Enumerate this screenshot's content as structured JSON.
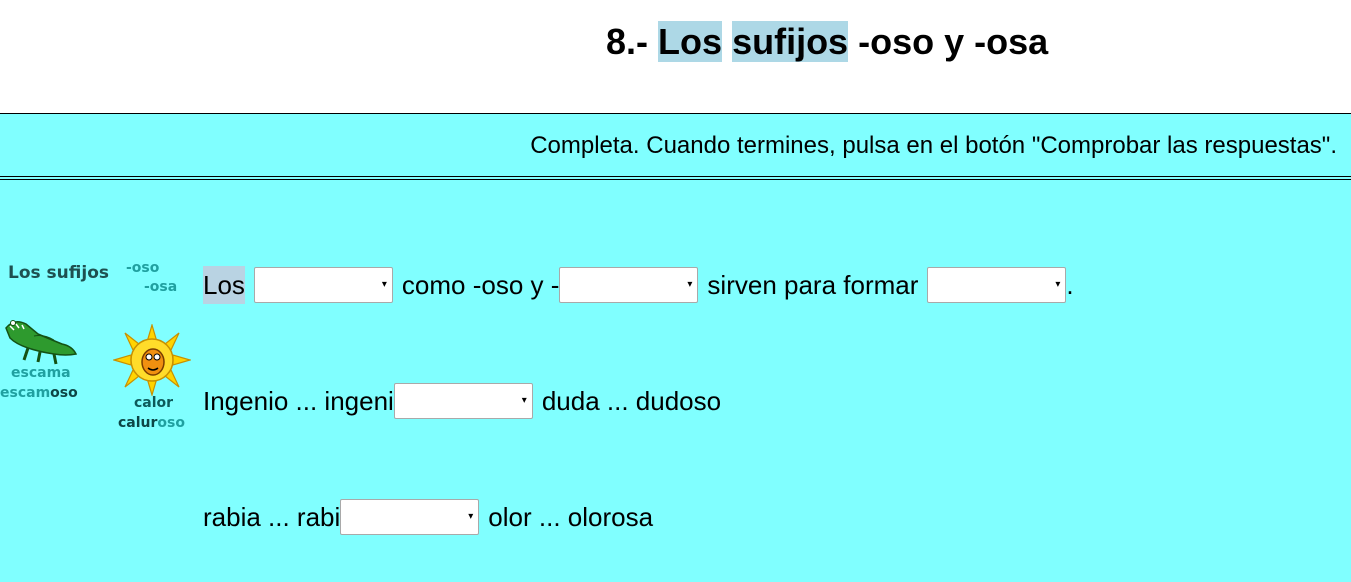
{
  "header": {
    "title_prefix": "8.-",
    "title_word1": "Los",
    "title_word2": "sufijos",
    "title_suffix": "-oso y -osa",
    "highlight_color": "#add8e6"
  },
  "instructions": "Completa. Cuando termines, pulsa en el botón \"Comprobar las respuestas\".",
  "background_color": "#80ffff",
  "sidebar": {
    "title": "Los sufijos",
    "suffix1": "-oso",
    "suffix2": "-osa",
    "example1": {
      "base": "escama",
      "derived_stem": "escam",
      "derived_suffix": "oso",
      "icon": "crocodile-icon"
    },
    "example2": {
      "base": "calor",
      "derived_stem": "calur",
      "derived_suffix": "oso",
      "icon": "sun-icon"
    }
  },
  "exercise": {
    "line1": {
      "t1": "Los",
      "t2": "como -oso y -",
      "t3": "sirven para formar",
      "t4": ".",
      "dropdown1": "",
      "dropdown2": "",
      "dropdown3": ""
    },
    "line2": {
      "t1": "Ingenio ... ingeni",
      "t2": "duda ... dudoso",
      "dropdown1": ""
    },
    "line3": {
      "t1": "rabia ... rabi",
      "t2": "olor ... olorosa",
      "dropdown1": ""
    },
    "dropdown_arrow": "▾"
  }
}
